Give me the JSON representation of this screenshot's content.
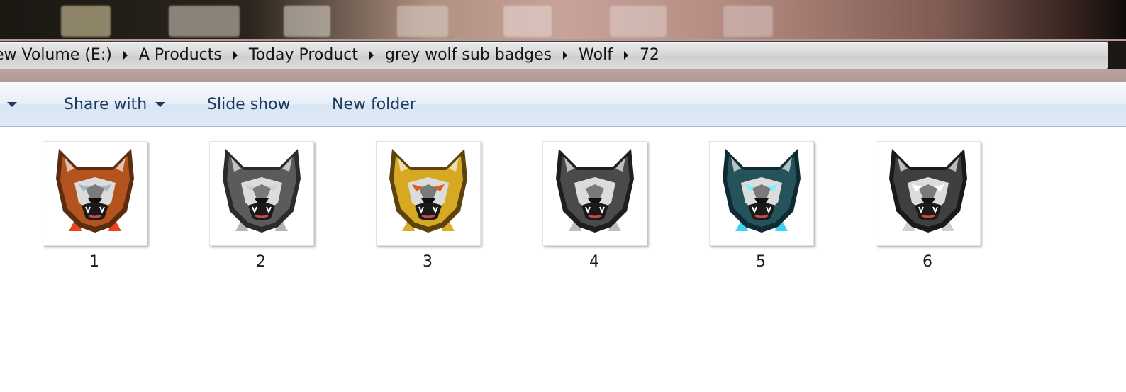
{
  "breadcrumb": {
    "items": [
      "ew Volume (E:)",
      "A Products",
      "Today Product",
      "grey wolf sub badges",
      "Wolf",
      "72"
    ]
  },
  "toolbar": {
    "share_with": "Share with",
    "slide_show": "Slide show",
    "new_folder": "New folder"
  },
  "files": [
    {
      "name": "1",
      "icon": "orange-wolf-badge-thumbnail",
      "fur": "#b4531d",
      "fur_dark": "#5a2c10",
      "bolt": "#e8431c",
      "eye": "#9fb9c9"
    },
    {
      "name": "2",
      "icon": "grey-wolf-badge-thumbnail",
      "fur": "#5b5b5b",
      "fur_dark": "#2b2b2b",
      "bolt": "#b5b5b5",
      "eye": "#cfcfcf"
    },
    {
      "name": "3",
      "icon": "yellow-wolf-badge-thumbnail",
      "fur": "#d7a821",
      "fur_dark": "#5c430e",
      "bolt": "#d8ae2e",
      "eye": "#e05a1a"
    },
    {
      "name": "4",
      "icon": "dark-grey-wolf-badge-thumbnail",
      "fur": "#4a4a4a",
      "fur_dark": "#1e1e1e",
      "bolt": "#bdbdbd",
      "eye": "#d9d9d9"
    },
    {
      "name": "5",
      "icon": "cyan-wolf-badge-thumbnail",
      "fur": "#24535c",
      "fur_dark": "#0f2a30",
      "bolt": "#43d2ee",
      "eye": "#7af3ff"
    },
    {
      "name": "6",
      "icon": "silver-wolf-badge-thumbnail",
      "fur": "#3f3f3f",
      "fur_dark": "#1a1a1a",
      "bolt": "#d0d0d0",
      "eye": "#ffffff"
    }
  ]
}
